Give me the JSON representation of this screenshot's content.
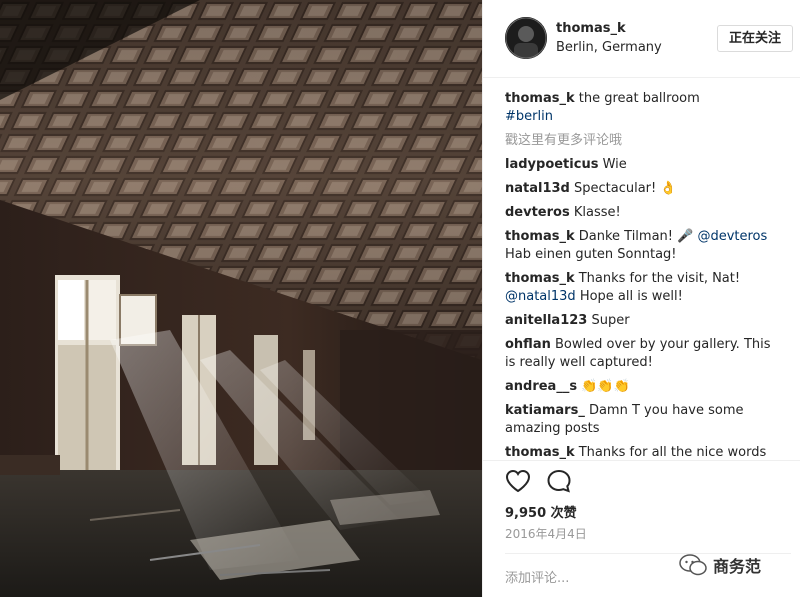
{
  "post": {
    "username": "thomas_k",
    "location": "Berlin, Germany",
    "follow_label": "正在关注",
    "caption_user": "thomas_k",
    "caption_text": " the great ballroom",
    "caption_tag": "#berlin",
    "more_comments": "戳这里有更多评论哦",
    "comments": [
      {
        "user": "ladypoeticus",
        "text": " Wie"
      },
      {
        "user": "natal13d",
        "text": " Spectacular! 👌"
      },
      {
        "user": "devteros",
        "text": " Klasse!"
      },
      {
        "user": "thomas_k",
        "text": " Danke Tilman! 🎤 ",
        "mention": "@devteros",
        "after": " Hab einen guten Sonntag!"
      },
      {
        "user": "thomas_k",
        "text": " Thanks for the visit, Nat! ",
        "mention": "@natal13d",
        "after": " Hope all is well!"
      },
      {
        "user": "anitella123",
        "text": " Super"
      },
      {
        "user": "ohflan",
        "text": " Bowled over by your gallery. This is really well captured!"
      },
      {
        "user": "andrea__s",
        "text": " 👏👏👏"
      },
      {
        "user": "katiamars_",
        "text": " Damn T you have some amazing posts"
      },
      {
        "user": "thomas_k",
        "text": " Thanks for all the nice words 🙏"
      }
    ],
    "likes": "9,950 次赞",
    "date": "2016年4月4日",
    "add_comment_placeholder": "添加评论...",
    "watermark_text": "商务范"
  },
  "icons": {
    "heart": "heart-icon",
    "comment": "comment-bubble-icon",
    "wechat": "wechat-icon"
  }
}
